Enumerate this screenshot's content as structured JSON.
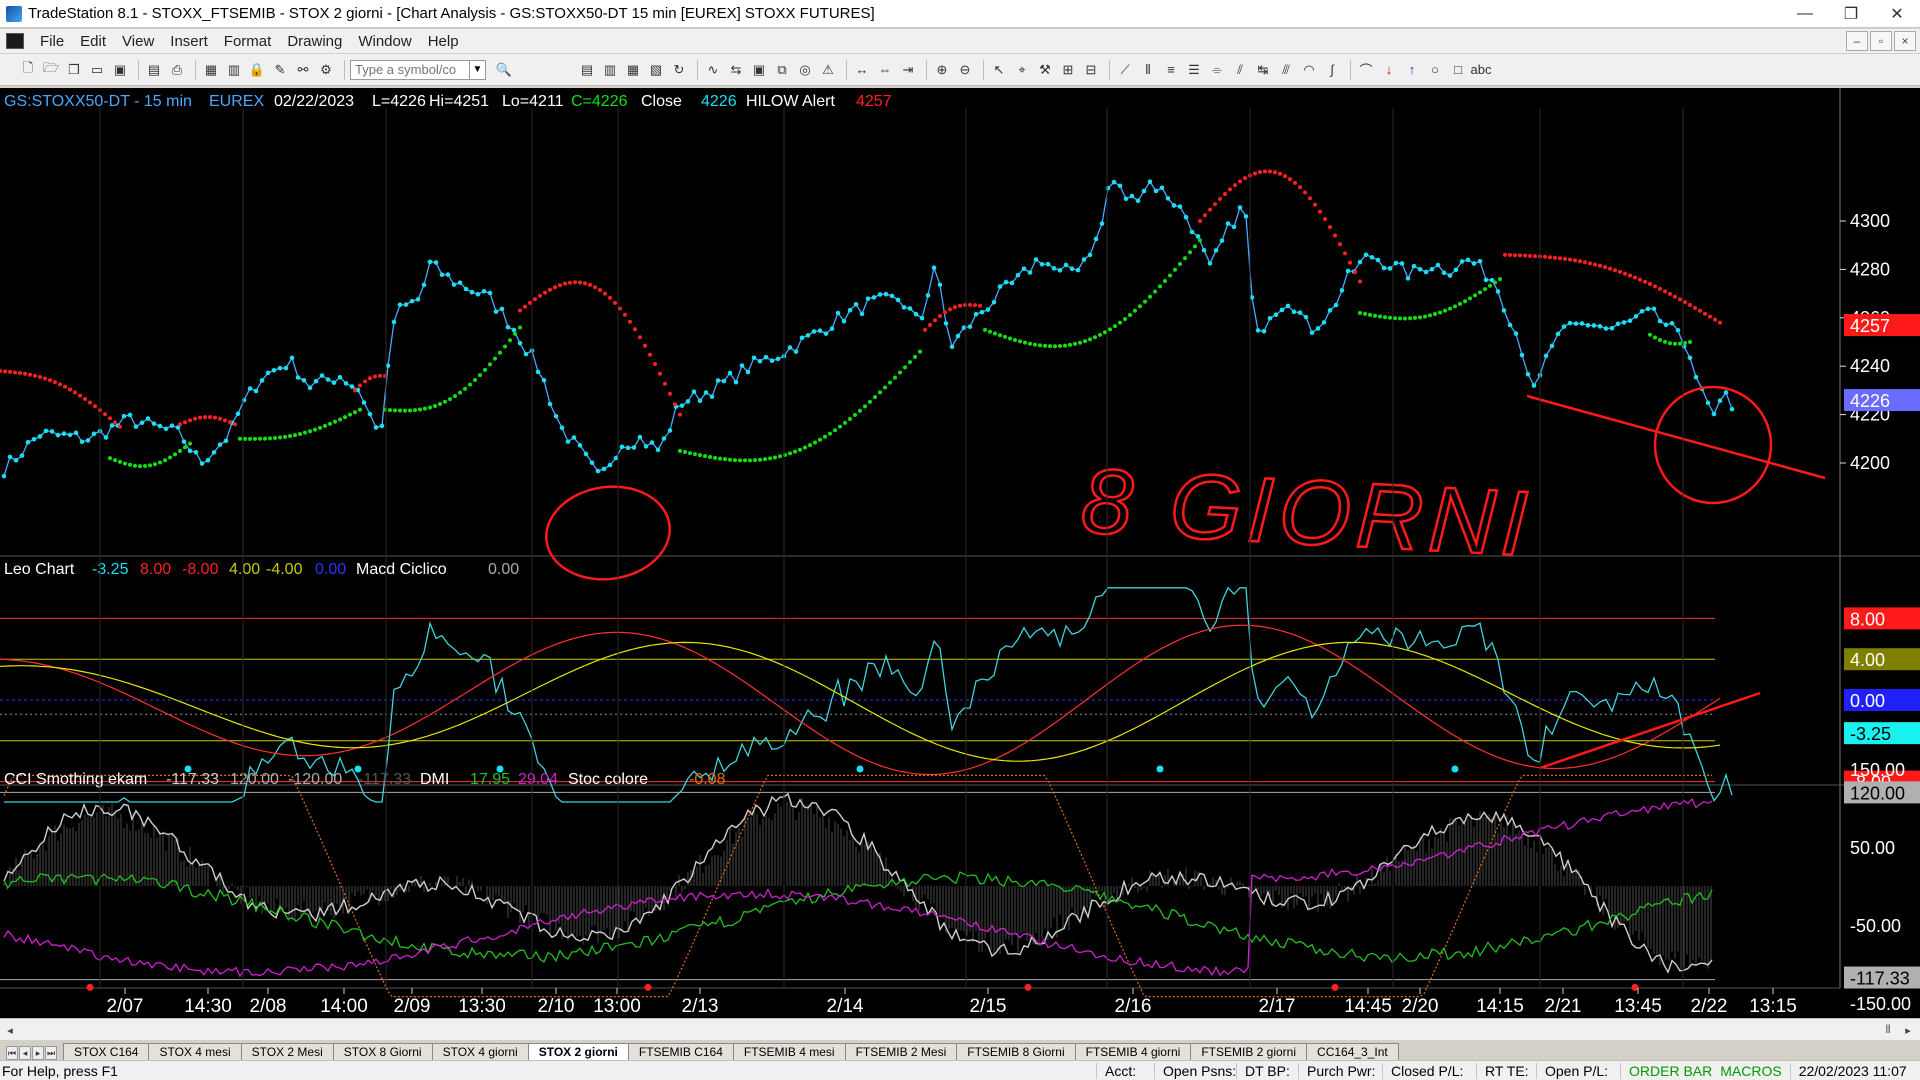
{
  "window": {
    "title": "TradeStation 8.1 - STOXX_FTSEMIB - STOX  2 giorni - [Chart Analysis - GS:STOXX50-DT  15 min  [EUREX] STOXX FUTURES]",
    "minimize": "—",
    "maximize": "❐",
    "close": "✕"
  },
  "menu": [
    "File",
    "Edit",
    "View",
    "Insert",
    "Format",
    "Drawing",
    "Window",
    "Help"
  ],
  "toolbar": {
    "symbol_placeholder": "Type a symbol/co"
  },
  "chart": {
    "header": {
      "symbol": "GS:STOXX50-DT - 15 min",
      "exchange": "EUREX",
      "date": "02/22/2023",
      "last": "L=4226",
      "high": "Hi=4251",
      "low": "Lo=4211",
      "close": "C=4226",
      "close_label": "Close",
      "close_value": "4226",
      "indicator": "HILOW Alert",
      "indicator_value": "4257"
    },
    "price_axis": {
      "ticks": [
        "4300",
        "4280",
        "4260",
        "4240",
        "4220",
        "4200"
      ],
      "last_marker": "4257",
      "close_marker": "4226"
    },
    "annotation_text": "8 GIORNI",
    "panel2": {
      "name": "Leo Chart",
      "values": [
        "-3.25",
        "8.00",
        "-8.00",
        "4.00",
        "-4.00",
        "0.00"
      ],
      "macd_label": "Macd Ciclico",
      "macd_value": "0.00",
      "axis_markers": [
        "8.00",
        "4.00",
        "0.00",
        "-3.25",
        "-8.00"
      ]
    },
    "panel3": {
      "name": "CCI Smothing ekam",
      "values": [
        "-117.33",
        "120.00",
        "-120.00",
        "-117.33"
      ],
      "dmi_label": "DMI",
      "dmi_values": [
        "17.95",
        "29.04"
      ],
      "stoc_label": "Stoc colore",
      "stoc_value": "-0.08",
      "axis_markers": [
        "150.00",
        "120.00",
        "50.00",
        "-50.00",
        "-117.33",
        "-150.00"
      ]
    },
    "time_axis": [
      "2/07",
      "14:30",
      "2/08",
      "14:00",
      "2/09",
      "13:30",
      "2/10",
      "13:00",
      "2/13",
      "2/14",
      "2/15",
      "2/16",
      "2/17",
      "14:45",
      "2/20",
      "14:15",
      "2/21",
      "13:45",
      "2/22",
      "13:15"
    ],
    "colors": {
      "price": "#4aa8ff",
      "dots": "#19e0f0",
      "sar_up": "#11e011",
      "sar_down": "#ff2020",
      "annotation": "#ff1a1a",
      "osc_cyan": "#3fd3dd",
      "osc_red": "#ff3030",
      "osc_yellow": "#e6e600",
      "cci_white": "#cfcfcf",
      "dmi_green": "#22c022",
      "dmi_magenta": "#d020d0",
      "stoc_orange": "#e07010"
    }
  },
  "tabs": [
    "STOX C164",
    "STOX 4 mesi",
    "STOX  2 Mesi",
    "STOX  8 Giorni",
    "STOX 4 giorni",
    "STOX  2 giorni",
    "FTSEMIB C164",
    "FTSEMIB 4 mesi",
    "FTSEMIB  2 Mesi",
    "FTSEMIB  8 Giorni",
    "FTSEMIB  4 giorni",
    "FTSEMIB  2 giorni",
    "CC164_3_Int"
  ],
  "active_tab": "STOX  2 giorni",
  "status": {
    "help": "For Help, press F1",
    "acct": "Acct:",
    "open_psns": "Open Psns:",
    "dt_bp": "DT BP:",
    "purch_pwr": "Purch Pwr:",
    "closed_pl": "Closed P/L:",
    "rt_te": "RT TE:",
    "open_pl": "Open P/L:",
    "order_bar": "ORDER BAR",
    "macros": "MACROS",
    "datetime": "22/02/2023 11:07"
  }
}
